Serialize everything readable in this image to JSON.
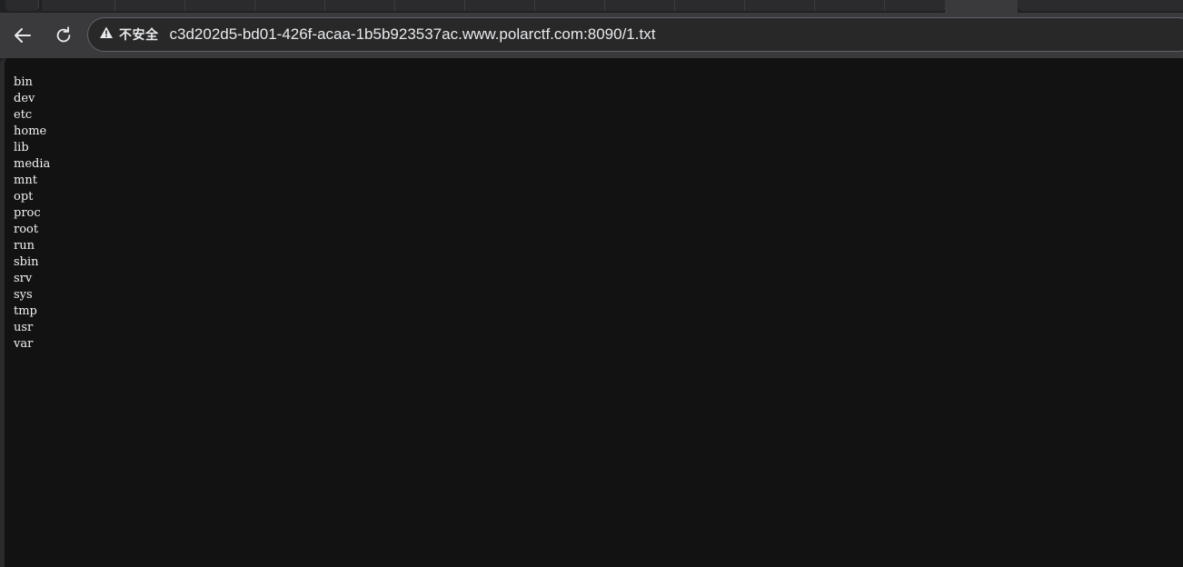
{
  "browser": {
    "security_label": "不安全",
    "url": "c3d202d5-bd01-426f-acaa-1b5b923537ac.www.polarctf.com:8090/1.txt",
    "icons": {
      "back": "arrow-left-icon",
      "reload": "reload-icon",
      "security": "warning-triangle-icon"
    }
  },
  "page": {
    "entries": [
      "bin",
      "dev",
      "etc",
      "home",
      "lib",
      "media",
      "mnt",
      "opt",
      "proc",
      "root",
      "run",
      "sbin",
      "srv",
      "sys",
      "tmp",
      "usr",
      "var"
    ]
  }
}
